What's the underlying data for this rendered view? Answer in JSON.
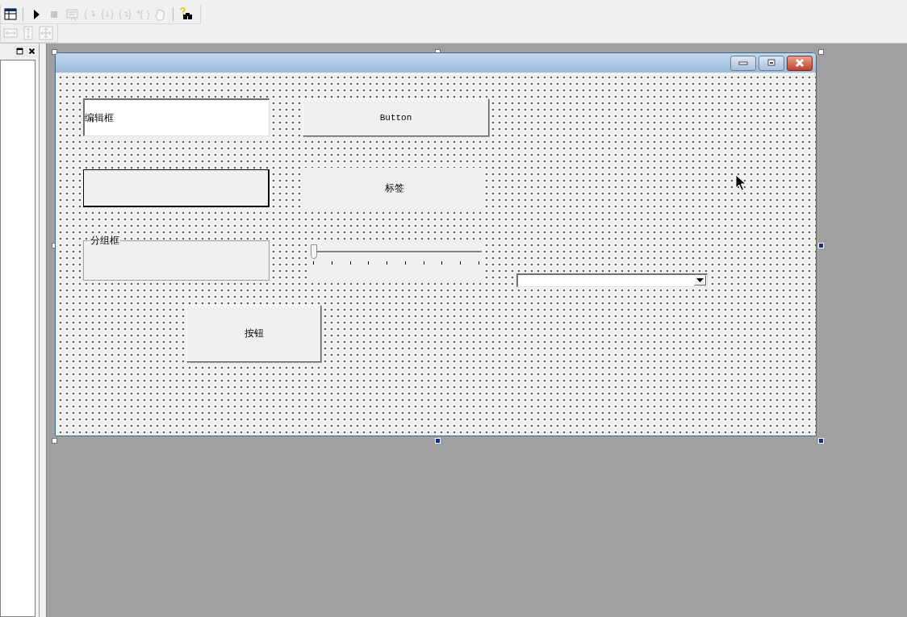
{
  "toolbar_1": [
    {
      "kind": "dialog",
      "disabled": false
    },
    {
      "kind": "run",
      "disabled": false
    },
    {
      "kind": "stop",
      "disabled": true
    },
    {
      "kind": "step-into",
      "disabled": true
    },
    {
      "kind": "brace-a",
      "disabled": true
    },
    {
      "kind": "brace-b",
      "disabled": true
    },
    {
      "kind": "brace-c",
      "disabled": true
    },
    {
      "kind": "brace-d",
      "disabled": true
    },
    {
      "kind": "hand",
      "disabled": true
    },
    {
      "kind": "find",
      "disabled": false
    }
  ],
  "toolbar_2": [
    {
      "kind": "width",
      "disabled": true
    },
    {
      "kind": "height",
      "disabled": true
    },
    {
      "kind": "both",
      "disabled": true
    }
  ],
  "dialog": {
    "controls": [
      {
        "kind": "edit",
        "text": "编辑框"
      },
      {
        "kind": "button",
        "text": "Button",
        "mono": true
      },
      {
        "kind": "frame"
      },
      {
        "kind": "label",
        "text": "标签"
      },
      {
        "kind": "group",
        "text": "分组框"
      },
      {
        "kind": "slider",
        "level": 0
      },
      {
        "kind": "combo"
      },
      {
        "kind": "button",
        "text": "按钮",
        "mono": false
      }
    ]
  }
}
